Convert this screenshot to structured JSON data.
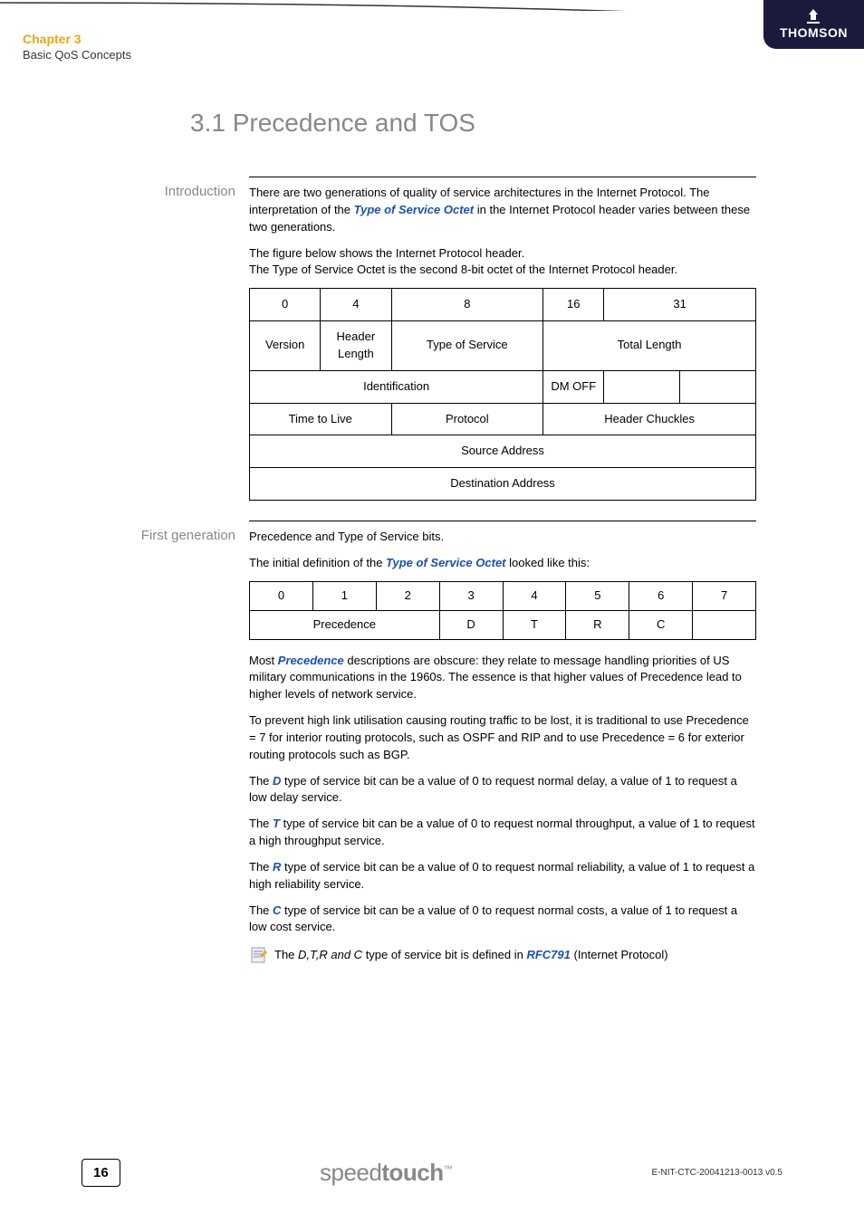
{
  "header": {
    "chapter": "Chapter 3",
    "subtitle": "Basic QoS Concepts",
    "brand": "THOMSON"
  },
  "title": "3.1  Precedence and TOS",
  "sections": {
    "intro": {
      "label": "Introduction",
      "p1a": "There are two generations of quality of service architectures in the Internet Protocol. The interpretation of the ",
      "p1_link": "Type of Service Octet",
      "p1b": " in the Internet Protocol header varies between these two generations.",
      "p2a": "The figure below shows the Internet Protocol header.",
      "p2b": "The Type of Service Octet is the second 8-bit octet of the Internet Protocol header.",
      "ip_header": {
        "bits": [
          "0",
          "4",
          "8",
          "16",
          "31"
        ],
        "r1": [
          "Version",
          "Header Length",
          "Type of Service",
          "Total Length"
        ],
        "r2": [
          "Identification",
          "DM OFF",
          ""
        ],
        "r3": [
          "Time to Live",
          "Protocol",
          "Header Chuckles"
        ],
        "r4": "Source Address",
        "r5": "Destination Address"
      }
    },
    "gen1": {
      "label": "First generation",
      "p1": "Precedence and Type of Service bits.",
      "p2a": "The initial definition of the ",
      "p2_link": "Type of Service Octet",
      "p2b": " looked like this:",
      "bits_table": {
        "header": [
          "0",
          "1",
          "2",
          "3",
          "4",
          "5",
          "6",
          "7"
        ],
        "row": [
          "Precedence",
          "D",
          "T",
          "R",
          "C",
          ""
        ]
      },
      "p3a": "Most ",
      "p3_link": "Precedence",
      "p3b": " descriptions are obscure: they relate to message handling priorities of US military communications in the 1960s. The essence is that higher values of Precedence lead to higher levels of network service.",
      "p4": "To prevent high link utilisation causing routing traffic to be lost, it is traditional to use Precedence = 7 for interior routing protocols, such as OSPF and RIP and to use Precedence = 6 for exterior routing protocols such as BGP.",
      "pD_a": "The ",
      "pD_l": "D",
      "pD_b": " type of service bit can be a value of 0 to request normal delay, a value of 1 to request a low delay service.",
      "pT_a": "The ",
      "pT_l": "T",
      "pT_b": " type of service bit can be a value of 0 to request normal throughput, a value of 1 to request a high throughput service.",
      "pR_a": "The ",
      "pR_l": "R",
      "pR_b": " type of service bit can be a value of 0 to request normal reliability, a value of 1 to request a high reliability service.",
      "pC_a": "The ",
      "pC_l": "C",
      "pC_b": " type of service bit can be a value of 0 to request normal costs, a value of 1 to request a low cost service.",
      "note_a": "The ",
      "note_i": "D,T,R and C",
      "note_b": " type of service bit is defined in ",
      "note_link": "RFC791",
      "note_c": " (Internet Protocol)"
    }
  },
  "footer": {
    "page": "16",
    "logo_thin": "speed",
    "logo_thick": "touch",
    "tm": "™",
    "docid": "E-NIT-CTC-20041213-0013 v0.5"
  }
}
